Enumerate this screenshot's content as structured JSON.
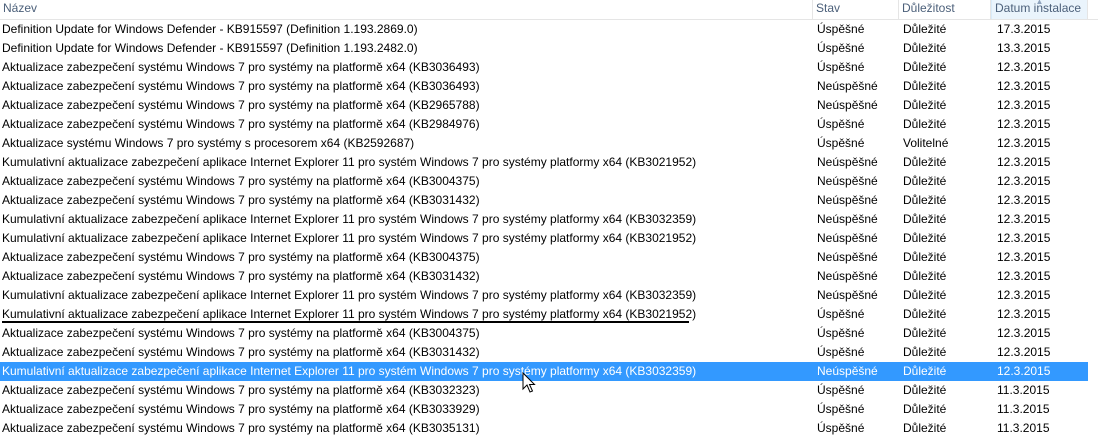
{
  "columns": {
    "name": "Název",
    "status": "Stav",
    "importance": "Důležitost",
    "date": "Datum instalace"
  },
  "rows": [
    {
      "name": "Definition Update for Windows Defender - KB915597 (Definition 1.193.2869.0)",
      "status": "Úspěšné",
      "importance": "Důležité",
      "date": "17.3.2015"
    },
    {
      "name": "Definition Update for Windows Defender - KB915597 (Definition 1.193.2482.0)",
      "status": "Úspěšné",
      "importance": "Důležité",
      "date": "13.3.2015"
    },
    {
      "name": "Aktualizace zabezpečení systému Windows 7 pro systémy na platformě x64 (KB3036493)",
      "status": "Úspěšné",
      "importance": "Důležité",
      "date": "12.3.2015"
    },
    {
      "name": "Aktualizace zabezpečení systému Windows 7 pro systémy na platformě x64 (KB3036493)",
      "status": "Neúspěšné",
      "importance": "Důležité",
      "date": "12.3.2015"
    },
    {
      "name": "Aktualizace zabezpečení systému Windows 7 pro systémy na platformě x64 (KB2965788)",
      "status": "Neúspěšné",
      "importance": "Důležité",
      "date": "12.3.2015"
    },
    {
      "name": "Aktualizace zabezpečení systému Windows 7 pro systémy na platformě x64 (KB2984976)",
      "status": "Úspěšné",
      "importance": "Důležité",
      "date": "12.3.2015"
    },
    {
      "name": "Aktualizace systému Windows 7 pro systémy s procesorem x64 (KB2592687)",
      "status": "Úspěšné",
      "importance": "Volitelné",
      "date": "12.3.2015"
    },
    {
      "name": "Kumulativní aktualizace zabezpečení aplikace Internet Explorer 11 pro systém Windows 7 pro systémy platformy x64 (KB3021952)",
      "status": "Neúspěšné",
      "importance": "Důležité",
      "date": "12.3.2015"
    },
    {
      "name": "Aktualizace zabezpečení systému Windows 7 pro systémy na platformě x64 (KB3004375)",
      "status": "Neúspěšné",
      "importance": "Důležité",
      "date": "12.3.2015"
    },
    {
      "name": "Aktualizace zabezpečení systému Windows 7 pro systémy na platformě x64 (KB3031432)",
      "status": "Neúspěšné",
      "importance": "Důležité",
      "date": "12.3.2015"
    },
    {
      "name": "Kumulativní aktualizace zabezpečení aplikace Internet Explorer 11 pro systém Windows 7 pro systémy platformy x64 (KB3032359)",
      "status": "Neúspěšné",
      "importance": "Důležité",
      "date": "12.3.2015"
    },
    {
      "name": "Kumulativní aktualizace zabezpečení aplikace Internet Explorer 11 pro systém Windows 7 pro systémy platformy x64 (KB3021952)",
      "status": "Neúspěšné",
      "importance": "Důležité",
      "date": "12.3.2015"
    },
    {
      "name": "Aktualizace zabezpečení systému Windows 7 pro systémy na platformě x64 (KB3004375)",
      "status": "Neúspěšné",
      "importance": "Důležité",
      "date": "12.3.2015"
    },
    {
      "name": "Aktualizace zabezpečení systému Windows 7 pro systémy na platformě x64 (KB3031432)",
      "status": "Neúspěšné",
      "importance": "Důležité",
      "date": "12.3.2015"
    },
    {
      "name": "Kumulativní aktualizace zabezpečení aplikace Internet Explorer 11 pro systém Windows 7 pro systémy platformy x64 (KB3032359)",
      "status": "Neúspěšné",
      "importance": "Důležité",
      "date": "12.3.2015"
    },
    {
      "name": "Kumulativní aktualizace zabezpečení aplikace Internet Explorer 11 pro systém Windows 7 pro systémy platformy x64 (KB3021952)",
      "status": "Úspěšné",
      "importance": "Důležité",
      "date": "12.3.2015"
    },
    {
      "name": "Aktualizace zabezpečení systému Windows 7 pro systémy na platformě x64 (KB3004375)",
      "status": "Úspěšné",
      "importance": "Důležité",
      "date": "12.3.2015"
    },
    {
      "name": "Aktualizace zabezpečení systému Windows 7 pro systémy na platformě x64 (KB3031432)",
      "status": "Úspěšné",
      "importance": "Důležité",
      "date": "12.3.2015"
    },
    {
      "name": "Kumulativní aktualizace zabezpečení aplikace Internet Explorer 11 pro systém Windows 7 pro systémy platformy x64 (KB3032359)",
      "status": "Neúspěšné",
      "importance": "Důležité",
      "date": "12.3.2015",
      "selected": true
    },
    {
      "name": "Aktualizace zabezpečení systému Windows 7 pro systémy na platformě x64 (KB3032323)",
      "status": "Úspěšné",
      "importance": "Důležité",
      "date": "11.3.2015"
    },
    {
      "name": "Aktualizace zabezpečení systému Windows 7 pro systémy na platformě x64 (KB3033929)",
      "status": "Úspěšné",
      "importance": "Důležité",
      "date": "11.3.2015"
    },
    {
      "name": "Aktualizace zabezpečení systému Windows 7 pro systémy na platformě x64 (KB3035131)",
      "status": "Úspěšné",
      "importance": "Důležité",
      "date": "11.3.2015"
    }
  ],
  "colors": {
    "selection": "#3399ff",
    "header_text": "#4c607a",
    "sorted_header_bg": "#eaf4fc"
  },
  "icons": {
    "sort": "sort-arrow-icon",
    "cursor": "mouse-pointer-icon"
  }
}
